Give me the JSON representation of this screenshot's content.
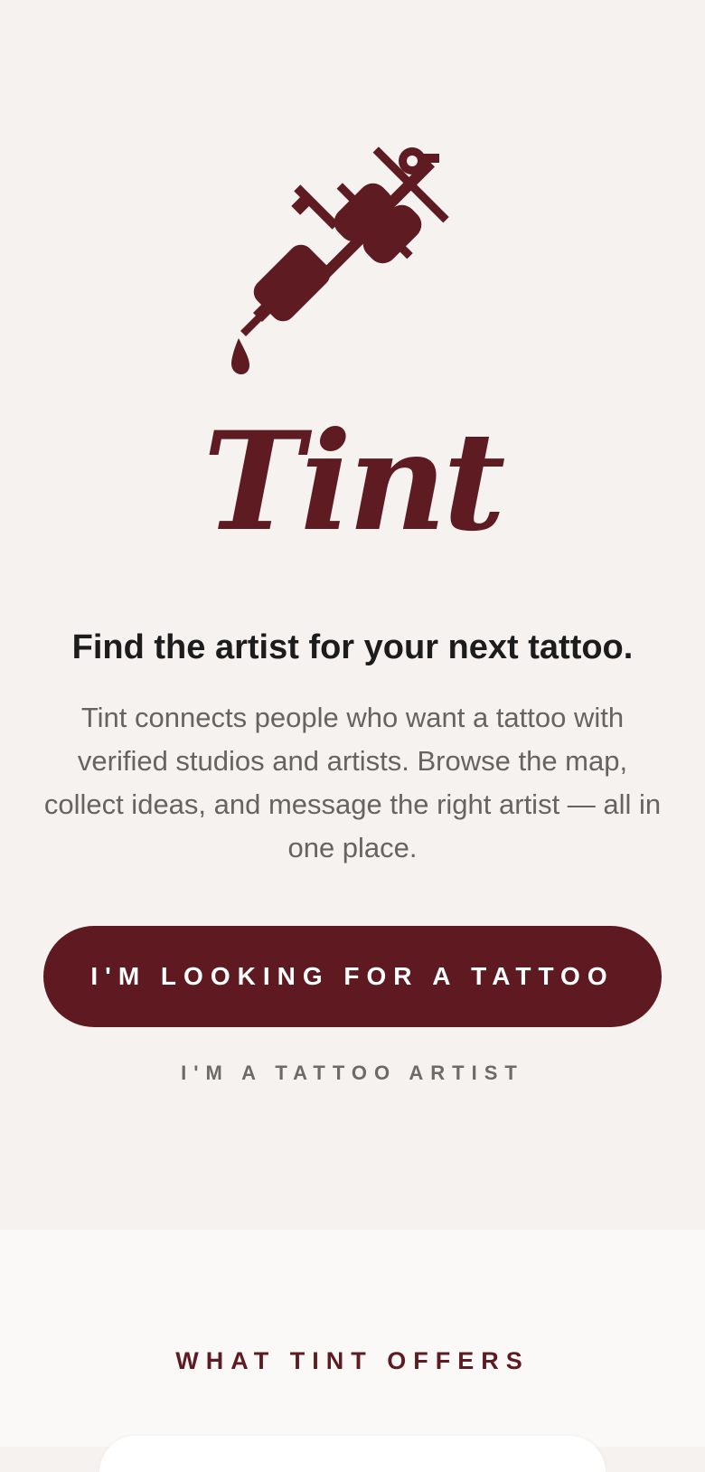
{
  "brand": {
    "name": "Tint",
    "logo_icon": "tattoo-machine-icon",
    "accent_color": "#5e1921"
  },
  "hero": {
    "headline": "Find the artist for your next tattoo.",
    "description": "Tint connects people who want a tattoo with verified studios and artists. Browse the map, collect ideas, and message the right artist — all in one place.",
    "primary_button": "I'M LOOKING FOR A TATTOO",
    "secondary_link": "I'M A TATTOO ARTIST"
  },
  "offers": {
    "heading": "WHAT TINT OFFERS"
  }
}
